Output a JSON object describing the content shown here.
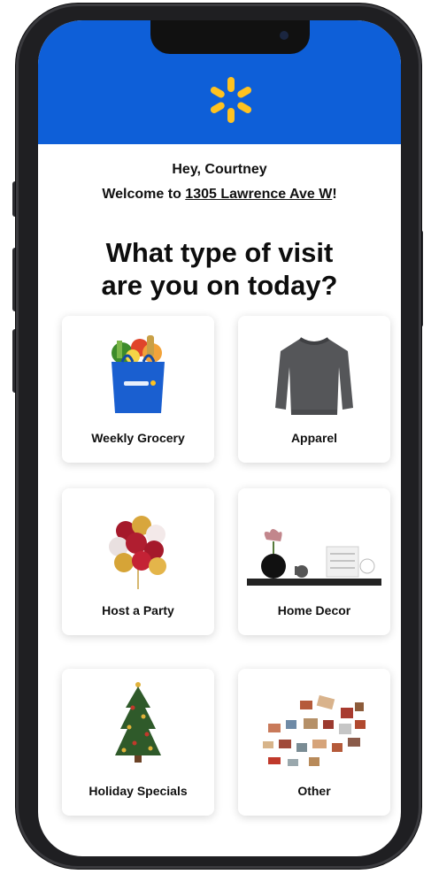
{
  "header": {
    "logo": "walmart-spark-icon",
    "brand_color": "#0e5fd8",
    "spark_color": "#ffc220"
  },
  "greeting": {
    "line1": "Hey, Courtney",
    "line2_prefix": "Welcome to ",
    "store_address": "1305 Lawrence Ave W",
    "line2_suffix": "!"
  },
  "question": {
    "line1": "What type of visit",
    "line2": "are you on today?"
  },
  "visit_types": [
    {
      "label": "Weekly Grocery",
      "icon": "grocery-bag-icon"
    },
    {
      "label": "Apparel",
      "icon": "sweater-icon"
    },
    {
      "label": "Host a Party",
      "icon": "balloons-icon"
    },
    {
      "label": "Home Decor",
      "icon": "decor-shelf-icon"
    },
    {
      "label": "Holiday Specials",
      "icon": "christmas-tree-icon"
    },
    {
      "label": "Other",
      "icon": "assorted-items-icon"
    }
  ]
}
